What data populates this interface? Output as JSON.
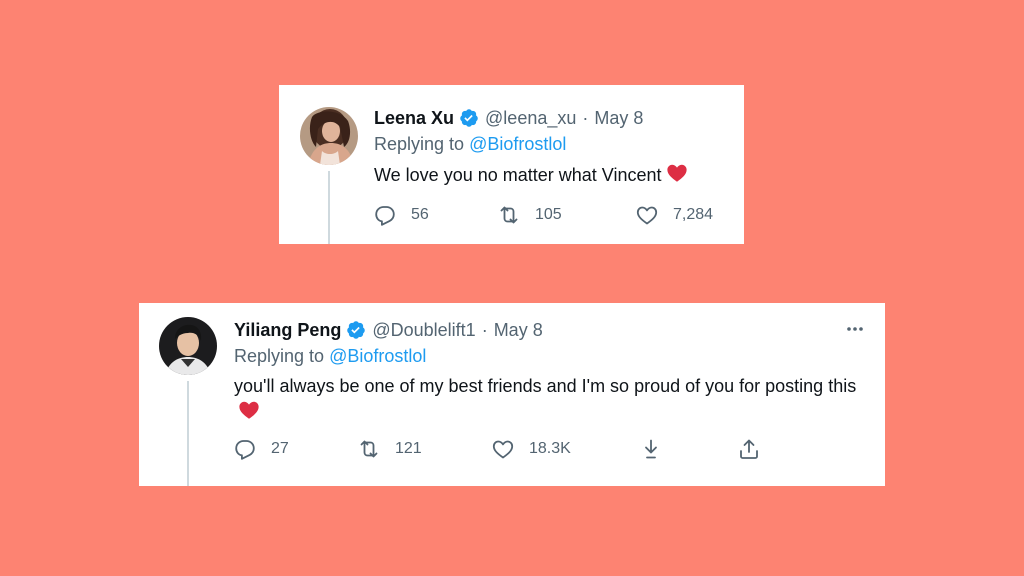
{
  "colors": {
    "background": "#fd8372",
    "card": "#ffffff",
    "link": "#1d9bf0",
    "secondary_text": "#536471",
    "verified_badge": "#1d9bf0",
    "heart_emoji": "#dd2e44"
  },
  "tweets": [
    {
      "name": "Leena Xu",
      "handle": "@leena_xu",
      "separator": "·",
      "date": "May 8",
      "replying_prefix": "Replying to",
      "replying_to": "@Biofrostlol",
      "text": "We love you no matter what Vincent",
      "emoji": "red-heart",
      "actions": [
        {
          "icon": "reply-icon",
          "count": "56"
        },
        {
          "icon": "retweet-icon",
          "count": "105"
        },
        {
          "icon": "like-icon",
          "count": "7,284"
        }
      ]
    },
    {
      "name": "Yiliang Peng",
      "handle": "@Doublelift1",
      "separator": "·",
      "date": "May 8",
      "replying_prefix": "Replying to",
      "replying_to": "@Biofrostlol",
      "text": "you'll always be one of my best friends and I'm so proud of you for posting this",
      "emoji": "red-heart",
      "actions": [
        {
          "icon": "reply-icon",
          "count": "27"
        },
        {
          "icon": "retweet-icon",
          "count": "121"
        },
        {
          "icon": "like-icon",
          "count": "18.3K"
        },
        {
          "icon": "download-icon",
          "count": ""
        },
        {
          "icon": "share-icon",
          "count": ""
        }
      ],
      "more_icon": "more-icon"
    }
  ]
}
